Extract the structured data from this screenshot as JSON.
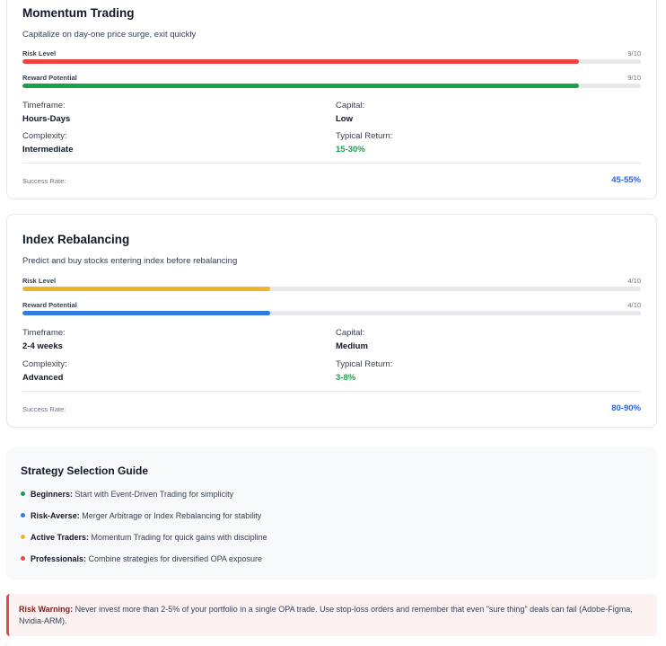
{
  "strategies": [
    {
      "title": "Momentum Trading",
      "description": "Capitalize on day-one price surge, exit quickly",
      "risk_label": "Risk Level",
      "risk_score": "9/10",
      "risk_level": 0.9,
      "risk_color": "#ef4444",
      "reward_label": "Reward Potential",
      "reward_score": "9/10",
      "reward_level": 0.9,
      "reward_color": "#16a34a",
      "timeframe_label": "Timeframe:",
      "timeframe": "Hours-Days",
      "capital_label": "Capital:",
      "capital": "Low",
      "complexity_label": "Complexity:",
      "complexity": "Intermediate",
      "typical_return_label": "Typical Return:",
      "typical_return": "15-30%",
      "success_rate_label": "Success Rate:",
      "success_rate": "45-55%"
    },
    {
      "title": "Index Rebalancing",
      "description": "Predict and buy stocks entering index before rebalancing",
      "risk_label": "Risk Level",
      "risk_score": "4/10",
      "risk_level": 0.4,
      "risk_color": "#f0b429",
      "reward_label": "Reward Potential",
      "reward_score": "4/10",
      "reward_level": 0.4,
      "reward_color": "#2f7de1",
      "timeframe_label": "Timeframe:",
      "timeframe": "2-4 weeks",
      "capital_label": "Capital:",
      "capital": "Medium",
      "complexity_label": "Complexity:",
      "complexity": "Advanced",
      "typical_return_label": "Typical Return:",
      "typical_return": "3-8%",
      "success_rate_label": "Success Rate:",
      "success_rate": "80-90%"
    }
  ],
  "guide": {
    "title": "Strategy Selection Guide",
    "items": [
      {
        "label": "Beginners:",
        "text": " Start with Event-Driven Trading for simplicity",
        "color": "#16a34a"
      },
      {
        "label": "Risk-Averse:",
        "text": " Merger Arbitrage or Index Rebalancing for stability",
        "color": "#2f7de1"
      },
      {
        "label": "Active Traders:",
        "text": " Momentum Trading for quick gains with discipline",
        "color": "#f0b429"
      },
      {
        "label": "Professionals:",
        "text": " Combine strategies for diversified OPA exposure",
        "color": "#ef4444"
      }
    ]
  },
  "warning": {
    "label": "Risk Warning:",
    "text": " Never invest more than 2-5% of your portfolio in a single OPA trade. Use stop-loss orders and remember that even \"sure thing\" deals can fail (Adobe-Figma, Nvidia-ARM)."
  }
}
